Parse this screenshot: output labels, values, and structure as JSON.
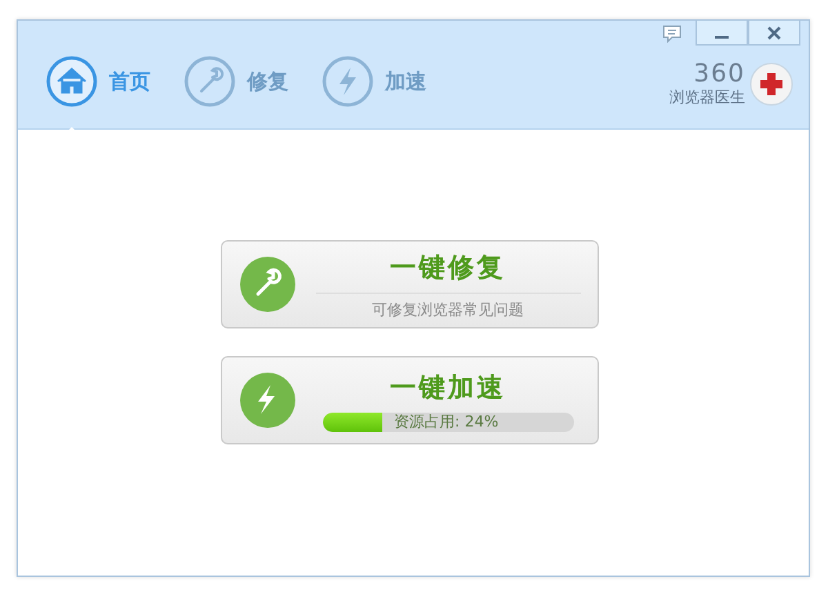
{
  "tabs": [
    {
      "label": "首页",
      "kind": "home",
      "selected": true
    },
    {
      "label": "修复",
      "kind": "wrench",
      "selected": false
    },
    {
      "label": "加速",
      "kind": "bolt",
      "selected": false
    }
  ],
  "brand": {
    "number": "360",
    "name": "浏览器医生"
  },
  "actions": [
    {
      "kind": "repair",
      "title": "一键修复",
      "subtitle": "可修复浏览器常见问题"
    },
    {
      "kind": "speed",
      "title": "一键加速",
      "reading": "资源占用: 24%",
      "level": 0.24
    }
  ]
}
